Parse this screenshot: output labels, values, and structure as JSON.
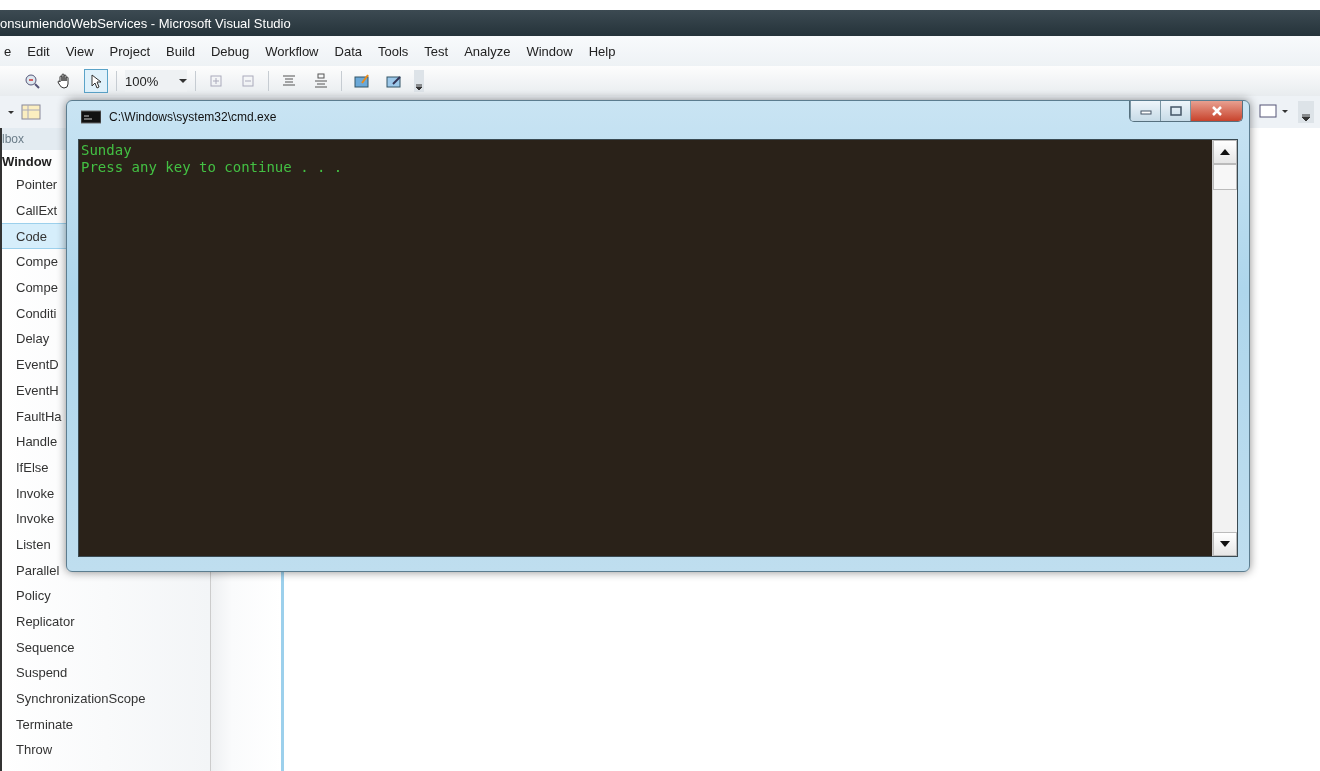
{
  "window": {
    "title": "onsumiendoWebServices - Microsoft Visual Studio"
  },
  "menu": [
    "e",
    "Edit",
    "View",
    "Project",
    "Build",
    "Debug",
    "Workflow",
    "Data",
    "Tools",
    "Test",
    "Analyze",
    "Window",
    "Help"
  ],
  "toolbar": {
    "zoom": "100%",
    "pointer_selected": true
  },
  "toolbox": {
    "title": "lbox",
    "group": "Window",
    "items": [
      {
        "label": "Pointer",
        "selected": false
      },
      {
        "label": "CallExt",
        "selected": false
      },
      {
        "label": "Code",
        "selected": true
      },
      {
        "label": "Compe",
        "selected": false
      },
      {
        "label": "Compe",
        "selected": false
      },
      {
        "label": "Conditi",
        "selected": false
      },
      {
        "label": "Delay",
        "selected": false
      },
      {
        "label": "EventD",
        "selected": false
      },
      {
        "label": "EventH",
        "selected": false
      },
      {
        "label": "FaultHa",
        "selected": false
      },
      {
        "label": "Handle",
        "selected": false
      },
      {
        "label": "IfElse",
        "selected": false
      },
      {
        "label": "Invoke",
        "selected": false
      },
      {
        "label": "Invoke",
        "selected": false
      },
      {
        "label": "Listen",
        "selected": false
      },
      {
        "label": "Parallel",
        "selected": false
      },
      {
        "label": "Policy",
        "selected": false
      },
      {
        "label": "Replicator",
        "selected": false
      },
      {
        "label": "Sequence",
        "selected": false
      },
      {
        "label": "Suspend",
        "selected": false
      },
      {
        "label": "SynchronizationScope",
        "selected": false
      },
      {
        "label": "Terminate",
        "selected": false
      },
      {
        "label": "Throw",
        "selected": false
      }
    ]
  },
  "console": {
    "title": "C:\\Windows\\system32\\cmd.exe",
    "lines": [
      "Sunday",
      "Press any key to continue . . ."
    ]
  }
}
